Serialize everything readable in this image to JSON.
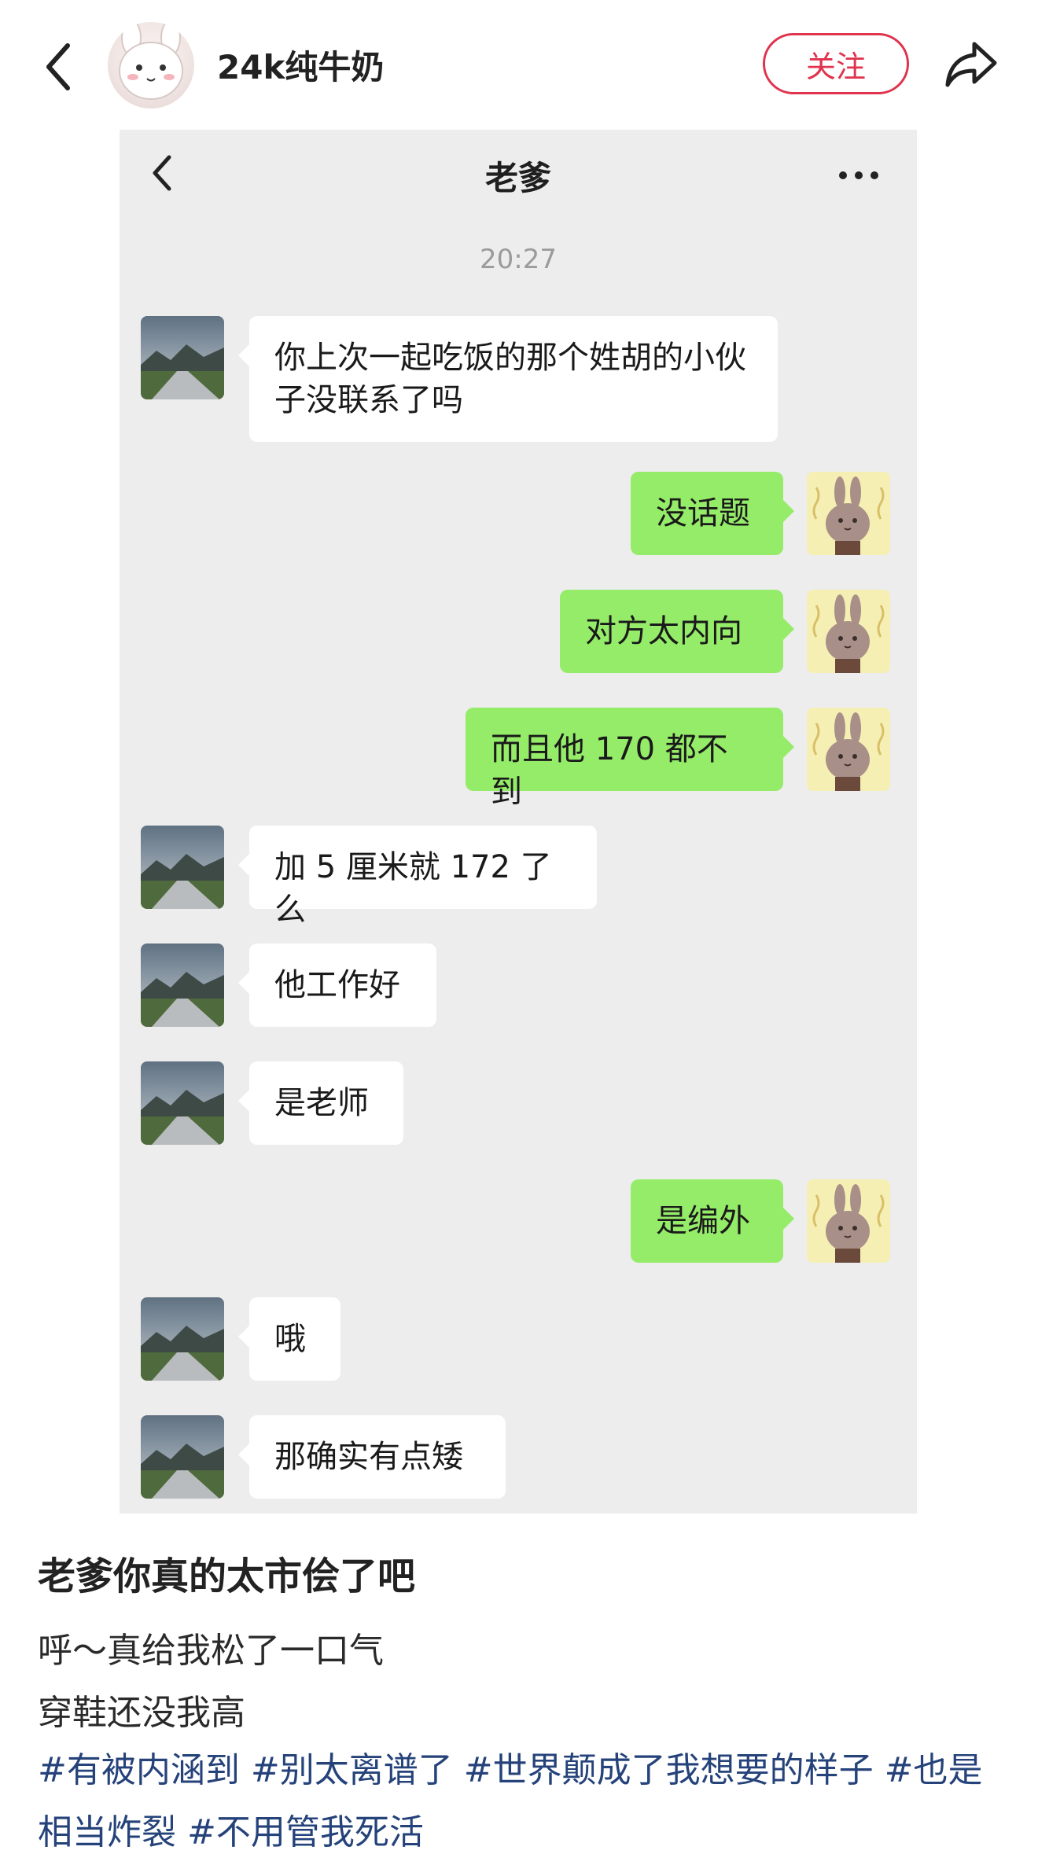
{
  "header": {
    "user_name": "24k纯牛奶",
    "follow_label": "关注"
  },
  "chat": {
    "title": "老爹",
    "time": "20:27",
    "messages": [
      {
        "side": "in",
        "text": "你上次一起吃饭的那个姓胡的小伙子没联系了吗"
      },
      {
        "side": "out",
        "text": "没话题"
      },
      {
        "side": "out",
        "text": "对方太内向"
      },
      {
        "side": "out",
        "text": "而且他 170 都不到"
      },
      {
        "side": "in",
        "text": "加 5 厘米就 172 了么"
      },
      {
        "side": "in",
        "text": "他工作好"
      },
      {
        "side": "in",
        "text": "是老师"
      },
      {
        "side": "out",
        "text": "是编外"
      },
      {
        "side": "in",
        "text": "哦"
      },
      {
        "side": "in",
        "text": "那确实有点矮"
      }
    ]
  },
  "post": {
    "title": "老爹你真的太市侩了吧",
    "lines": [
      "呼～真给我松了一口气",
      "穿鞋还没我高"
    ],
    "tags": [
      "#有被内涵到",
      "#别太离谱了",
      "#世界颠成了我想要的样子",
      "#也是相当炸裂",
      "#不用管我死活"
    ]
  },
  "colors": {
    "accent_red": "#e0334d",
    "bubble_green": "#95ec69",
    "tag_blue": "#25437a"
  }
}
